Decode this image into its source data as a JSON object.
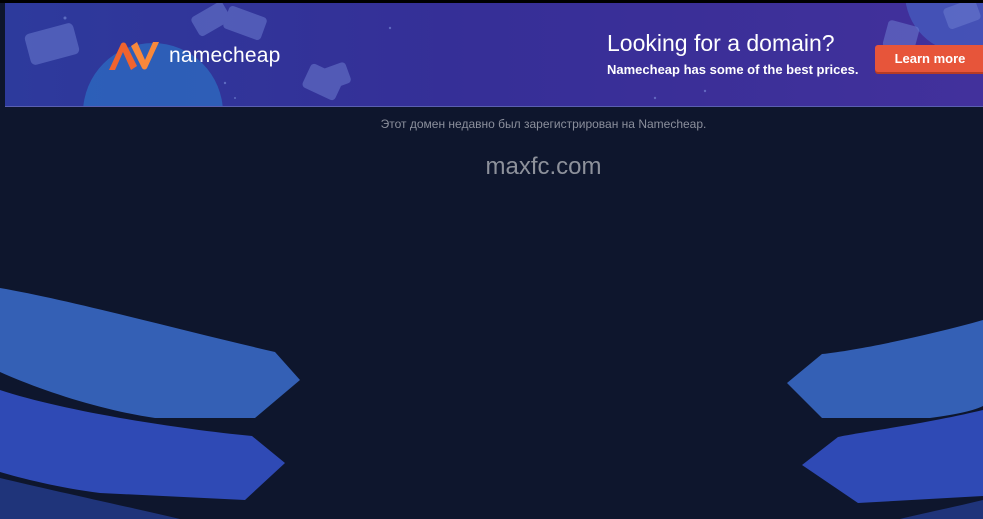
{
  "banner": {
    "brand_name": "namecheap",
    "headline": "Looking for a domain?",
    "subline": "Namecheap has some of the best prices.",
    "cta_label": "Learn more",
    "brand_color": "#f0632e",
    "cta_color": "#e7553a"
  },
  "notice": "Этот домен недавно был зарегистрирован на Namecheap.",
  "domain": "maxfc.com",
  "colors": {
    "background": "#0e162d",
    "band_light": "#3a5fb8",
    "band_dark": "#2f46b0"
  }
}
